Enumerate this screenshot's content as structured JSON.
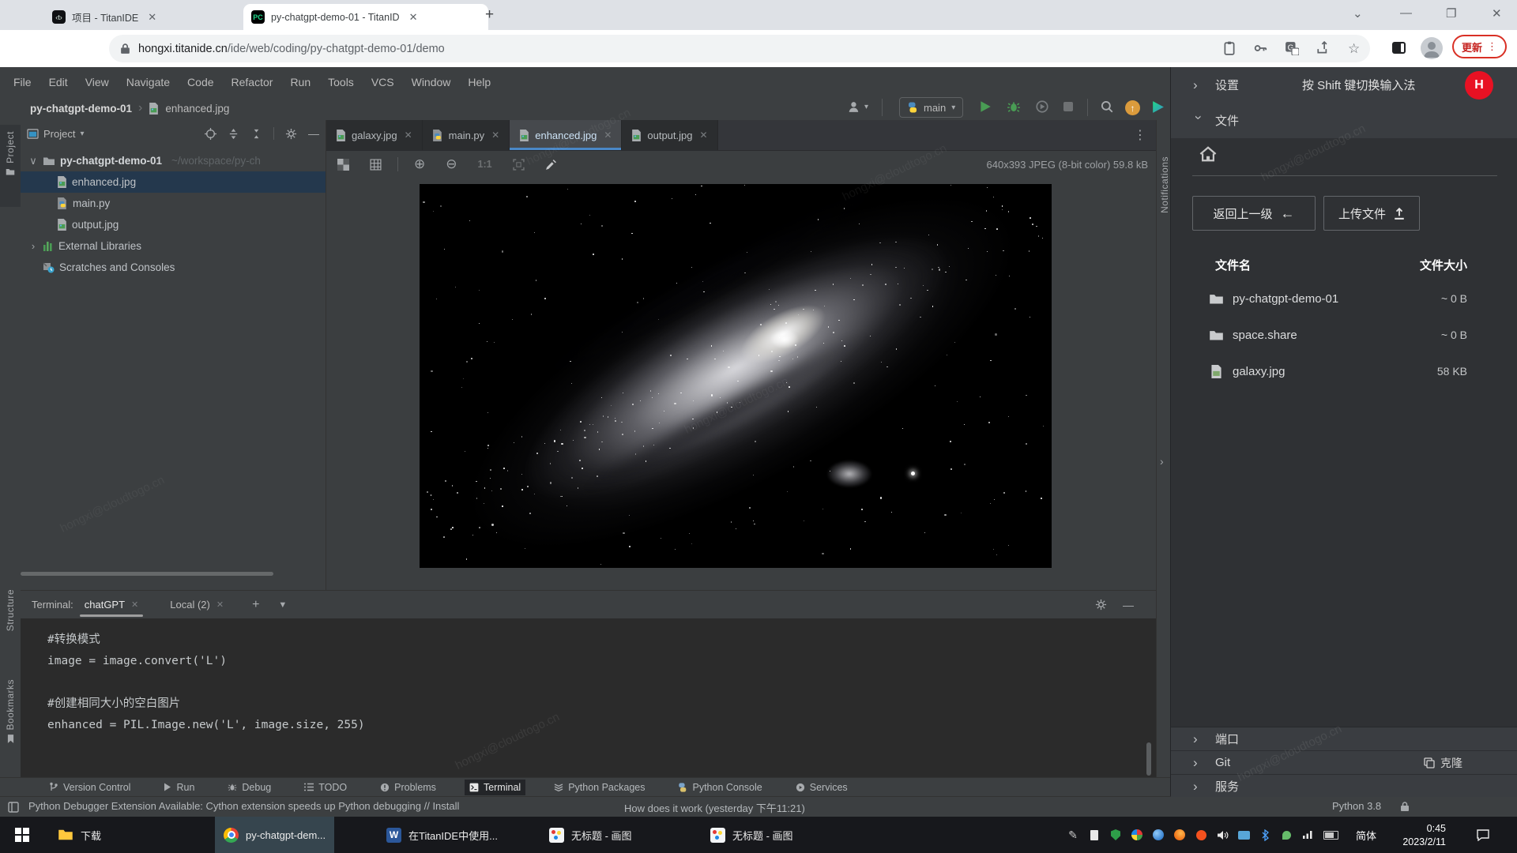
{
  "browser": {
    "tab1": {
      "title": "项目 - TitanIDE",
      "favicon": "‹t›"
    },
    "tab2": {
      "title": "py-chatgpt-demo-01 - TitanID",
      "favicon": "PC"
    },
    "url_domain": "hongxi.titanide.cn",
    "url_path": "/ide/web/coding/py-chatgpt-demo-01/demo",
    "update_label": "更新"
  },
  "menu": {
    "items": [
      "File",
      "Edit",
      "View",
      "Navigate",
      "Code",
      "Refactor",
      "Run",
      "Tools",
      "VCS",
      "Window",
      "Help"
    ]
  },
  "toolbar": {
    "crumb_project": "py-chatgpt-demo-01",
    "crumb_file": "enhanced.jpg",
    "run_config": "main"
  },
  "project": {
    "title": "Project",
    "root": {
      "label": "py-chatgpt-demo-01",
      "path": "~/workspace/py-ch"
    },
    "file1": "enhanced.jpg",
    "file2": "main.py",
    "file3": "output.jpg",
    "libs": "External Libraries",
    "scratches": "Scratches and Consoles"
  },
  "stripes": {
    "left_top": "Project",
    "left_mid": "Structure",
    "left_bottom": "Bookmarks",
    "right": "Notifications"
  },
  "editor": {
    "tabs": [
      {
        "label": "galaxy.jpg"
      },
      {
        "label": "main.py"
      },
      {
        "label": "enhanced.jpg"
      },
      {
        "label": "output.jpg"
      }
    ],
    "zoom_label": "1:1",
    "image_info": "640x393 JPEG (8-bit color) 59.8 kB"
  },
  "terminal": {
    "label": "Terminal:",
    "tab1": "chatGPT",
    "tab2": "Local (2)",
    "lines": [
      "#转换模式",
      "image = image.convert('L')",
      "",
      "#创建相同大小的空白图片",
      "enhanced = PIL.Image.new('L', image.size, 255)"
    ]
  },
  "toolwindows": {
    "items": [
      "Version Control",
      "Run",
      "Debug",
      "TODO",
      "Problems",
      "Terminal",
      "Python Packages",
      "Python Console",
      "Services"
    ]
  },
  "statusbar": {
    "message": "Python Debugger Extension Available: Cython extension speeds up Python debugging // Install",
    "secondary": "How does it work (yesterday 下午11:21)",
    "interpreter": "Python 3.8"
  },
  "drawer": {
    "settings": "设置",
    "ime_hint": "按 Shift 键切换输入法",
    "avatar": "H",
    "files": "文件",
    "back_button": "返回上一级",
    "upload_button": "上传文件",
    "col_name": "文件名",
    "col_size": "文件大小",
    "rows": [
      {
        "name": "py-chatgpt-demo-01",
        "size": "~ 0 B"
      },
      {
        "name": "space.share",
        "size": "~ 0 B"
      },
      {
        "name": "galaxy.jpg",
        "size": "58 KB"
      }
    ],
    "sec_ports": "端口",
    "sec_git": "Git",
    "git_action": "克隆",
    "sec_services": "服务"
  },
  "taskbar": {
    "items": [
      {
        "label": "下载"
      },
      {
        "label": "py-chatgpt-dem..."
      },
      {
        "label": "在TitanIDE中使用..."
      },
      {
        "label": "无标题 - 画图"
      },
      {
        "label": "无标题 - 画图"
      }
    ],
    "lang": "简体",
    "time": "0:45",
    "date": "2023/2/11"
  },
  "watermark": "hongxi@cloudtogo.cn"
}
